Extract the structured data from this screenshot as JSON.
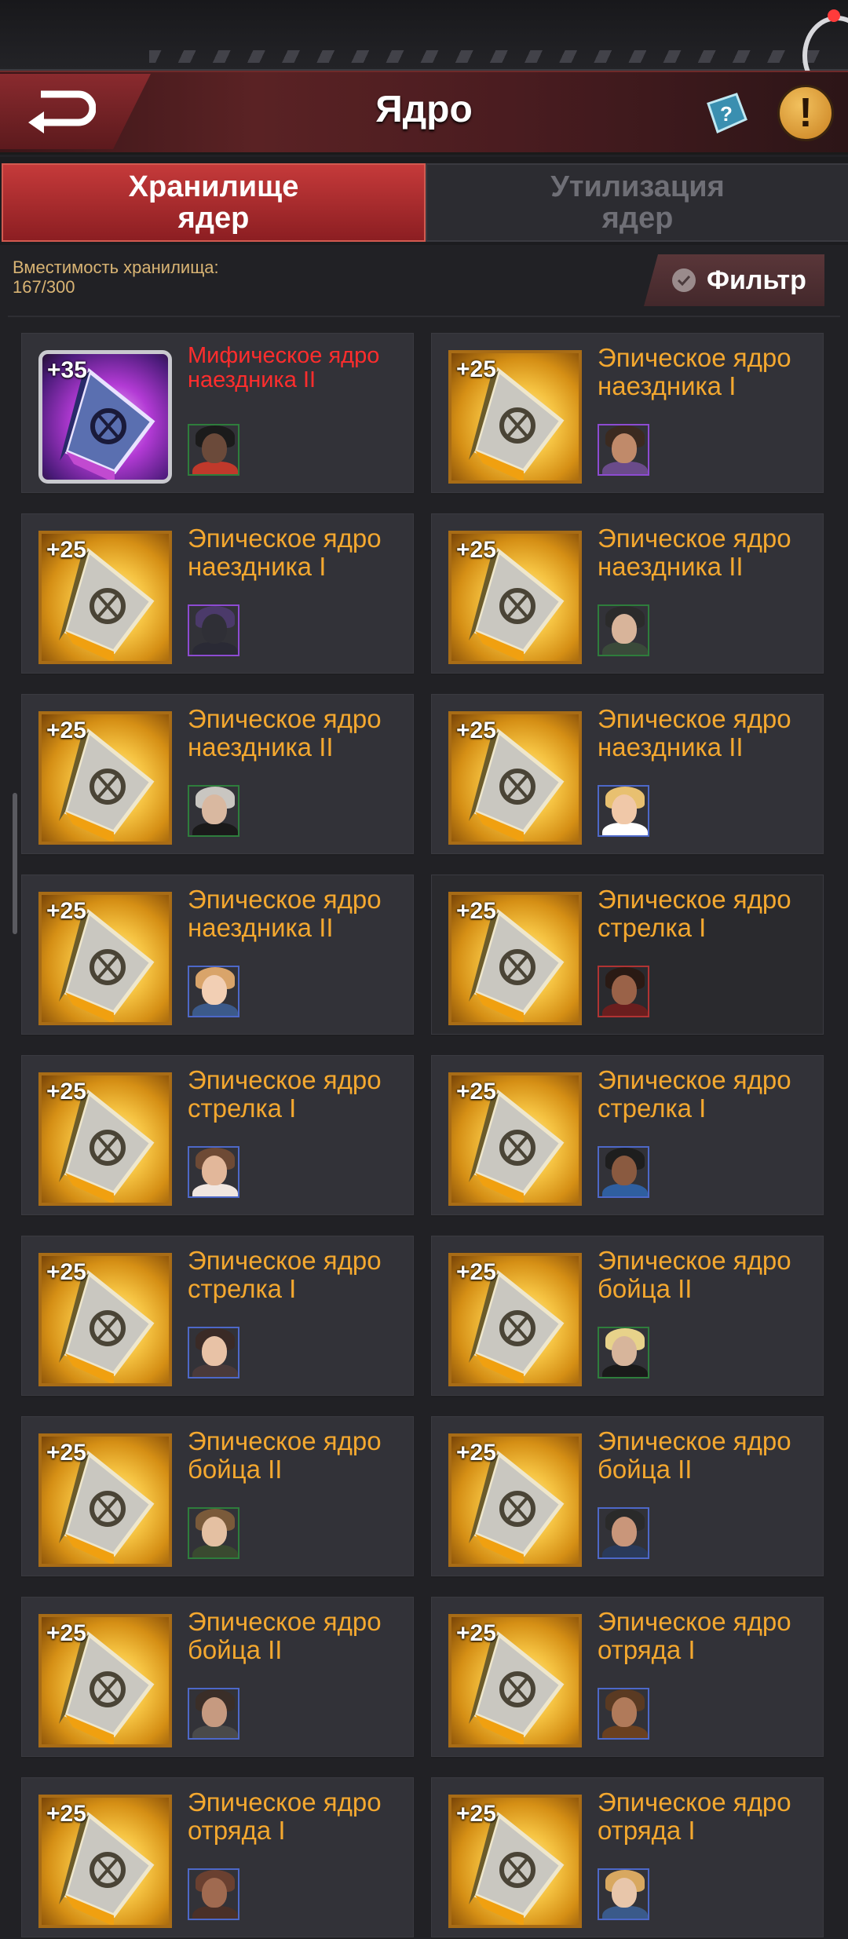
{
  "header": {
    "title": "Ядро",
    "info_label": "!"
  },
  "tabs": [
    {
      "label": "Хранилище ядер",
      "active": true
    },
    {
      "label": "Утилизация ядер",
      "active": false
    }
  ],
  "storage": {
    "capacity_label": "Вместимость хранилища:",
    "capacity_value": "167/300"
  },
  "filter": {
    "label": "Фильтр"
  },
  "colors": {
    "accent_red": "#c53a3a",
    "epic_gold": "#f4a82f",
    "mythic_red": "#ff2d2d",
    "card_bg": "#323238"
  },
  "cores": [
    {
      "plus": "+35",
      "title": "Мифическое ядро наездника II",
      "rarity": "mythic",
      "avatar": {
        "skin": "#6b4a3a",
        "hair": "#1b1b1b",
        "body": "#c0392b",
        "frame": "green"
      }
    },
    {
      "plus": "+25",
      "title": "Эпическое ядро наездника I",
      "rarity": "epic",
      "avatar": {
        "skin": "#c08a6a",
        "hair": "#3b2a20",
        "body": "#6a4b8a",
        "frame": "purple"
      }
    },
    {
      "plus": "+25",
      "title": "Эпическое ядро наездника I",
      "rarity": "epic",
      "avatar": {
        "skin": "#2f2f36",
        "hair": "#4b3a6a",
        "body": "#2a2a35",
        "frame": "purple"
      }
    },
    {
      "plus": "+25",
      "title": "Эпическое ядро наездника II",
      "rarity": "epic",
      "avatar": {
        "skin": "#d8b49a",
        "hair": "#2b2b2b",
        "body": "#3a4a3a",
        "frame": "green"
      }
    },
    {
      "plus": "+25",
      "title": "Эпическое ядро наездника II",
      "rarity": "epic",
      "avatar": {
        "skin": "#d9b8a0",
        "hair": "#c9c6c1",
        "body": "#1a1a1a",
        "frame": "green"
      }
    },
    {
      "plus": "+25",
      "title": "Эпическое ядро наездника II",
      "rarity": "epic",
      "avatar": {
        "skin": "#f0c8a8",
        "hair": "#e8c070",
        "body": "#ffffff",
        "frame": "blue"
      }
    },
    {
      "plus": "+25",
      "title": "Эпическое ядро наездника II",
      "rarity": "epic",
      "avatar": {
        "skin": "#f2cfb4",
        "hair": "#d9a46a",
        "body": "#3c5a8a",
        "frame": "blue"
      }
    },
    {
      "plus": "+25",
      "title": "Эпическое ядро стрелка I",
      "rarity": "epic",
      "dim": true,
      "avatar": {
        "skin": "#9a6248",
        "hair": "#2a1a14",
        "body": "#6a1e1e",
        "frame": "red"
      }
    },
    {
      "plus": "+25",
      "title": "Эпическое ядро стрелка I",
      "rarity": "epic",
      "avatar": {
        "skin": "#e2b79a",
        "hair": "#6e4a35",
        "body": "#f0e6e0",
        "frame": "blue"
      }
    },
    {
      "plus": "+25",
      "title": "Эпическое ядро стрелка I",
      "rarity": "epic",
      "avatar": {
        "skin": "#8a5a40",
        "hair": "#1e1e1e",
        "body": "#2f5fa0",
        "frame": "blue"
      }
    },
    {
      "plus": "+25",
      "title": "Эпическое ядро стрелка I",
      "rarity": "epic",
      "avatar": {
        "skin": "#e8c2a6",
        "hair": "#3a2a26",
        "body": "#4a3a3a",
        "frame": "blue"
      }
    },
    {
      "plus": "+25",
      "title": "Эпическое ядро бойца II",
      "rarity": "epic",
      "avatar": {
        "skin": "#d7b59b",
        "hair": "#e7d28a",
        "body": "#1a1a1a",
        "frame": "green"
      }
    },
    {
      "plus": "+25",
      "title": "Эпическое ядро бойца II",
      "rarity": "epic",
      "avatar": {
        "skin": "#e4c0a2",
        "hair": "#7a5a3a",
        "body": "#3a4a30",
        "frame": "green"
      }
    },
    {
      "plus": "+25",
      "title": "Эпическое ядро бойца II",
      "rarity": "epic",
      "avatar": {
        "skin": "#c9967a",
        "hair": "#2a2a2a",
        "body": "#2a3a5a",
        "frame": "blue"
      }
    },
    {
      "plus": "+25",
      "title": "Эпическое ядро бойца II",
      "rarity": "epic",
      "avatar": {
        "skin": "#c69a80",
        "hair": "#3a2e28",
        "body": "#4a4a4a",
        "frame": "blue"
      }
    },
    {
      "plus": "+25",
      "title": "Эпическое ядро отряда I",
      "rarity": "epic",
      "avatar": {
        "skin": "#b07a5a",
        "hair": "#5a3a22",
        "body": "#6a4020",
        "frame": "blue"
      }
    },
    {
      "plus": "+25",
      "title": "Эпическое ядро отряда I",
      "rarity": "epic",
      "avatar": {
        "skin": "#a06a50",
        "hair": "#6a4030",
        "body": "#4a3028",
        "frame": "blue"
      }
    },
    {
      "plus": "+25",
      "title": "Эпическое ядро отряда I",
      "rarity": "epic",
      "avatar": {
        "skin": "#e8c6aa",
        "hair": "#d8a860",
        "body": "#3a5a8a",
        "frame": "blue"
      }
    }
  ]
}
